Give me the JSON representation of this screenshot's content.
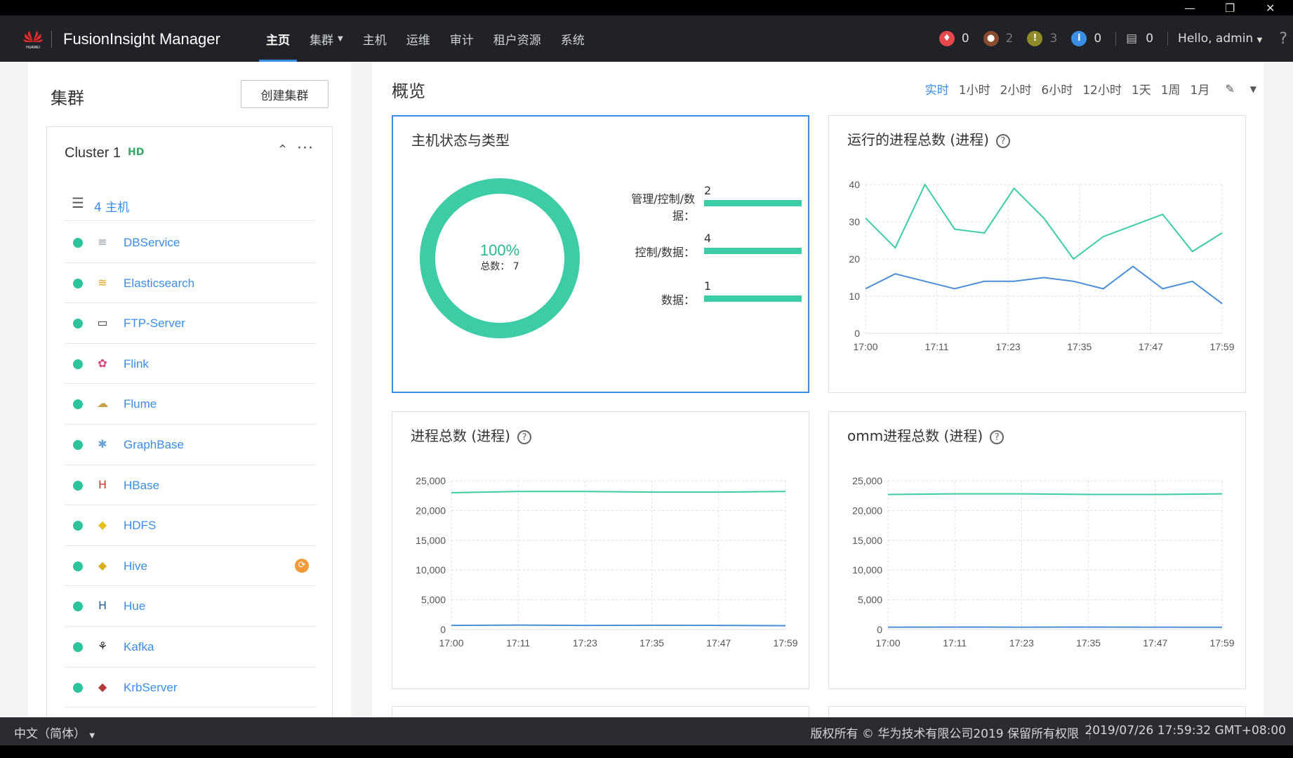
{
  "window": {
    "minimize": "—",
    "restore": "❐",
    "close": "✕"
  },
  "topbar": {
    "brand": "FusionInsight Manager",
    "nav": [
      {
        "label": "主页",
        "active": true,
        "caret": false
      },
      {
        "label": "集群",
        "active": false,
        "caret": true
      },
      {
        "label": "主机",
        "active": false,
        "caret": false
      },
      {
        "label": "运维",
        "active": false,
        "caret": false
      },
      {
        "label": "审计",
        "active": false,
        "caret": false
      },
      {
        "label": "租户资源",
        "active": false,
        "caret": false
      },
      {
        "label": "系统",
        "active": false,
        "caret": false
      }
    ],
    "alarms": [
      {
        "icon": "critical-alarm-icon",
        "color": "#e5484d",
        "count": "0",
        "dim": false
      },
      {
        "icon": "major-alarm-icon",
        "color": "#8a4b2f",
        "count": "2",
        "dim": true
      },
      {
        "icon": "minor-alarm-icon",
        "color": "#8f8a2a",
        "count": "3",
        "dim": true
      },
      {
        "icon": "info-alarm-icon",
        "color": "#3a8ee6",
        "count": "0",
        "dim": false
      }
    ],
    "tasks_count": "0",
    "greeting": "Hello, admin",
    "help": "?"
  },
  "left": {
    "title": "集群",
    "create_button": "创建集群",
    "cluster": {
      "name": "Cluster 1",
      "tag": "HD",
      "hosts_label": "4 主机",
      "services": [
        {
          "name": "DBService",
          "icon": "dbservice-icon",
          "glyph": "≡",
          "color": "#8a8f99",
          "badge": ""
        },
        {
          "name": "Elasticsearch",
          "icon": "elasticsearch-icon",
          "glyph": "≋",
          "color": "#e8a21c",
          "badge": ""
        },
        {
          "name": "FTP-Server",
          "icon": "ftp-server-icon",
          "glyph": "▭",
          "color": "#333",
          "badge": ""
        },
        {
          "name": "Flink",
          "icon": "flink-icon",
          "glyph": "✿",
          "color": "#d9447a",
          "badge": ""
        },
        {
          "name": "Flume",
          "icon": "flume-icon",
          "glyph": "☁",
          "color": "#c8a04a",
          "badge": ""
        },
        {
          "name": "GraphBase",
          "icon": "graphbase-icon",
          "glyph": "✱",
          "color": "#6aa3d8",
          "badge": ""
        },
        {
          "name": "HBase",
          "icon": "hbase-icon",
          "glyph": "H",
          "color": "#c0392b",
          "badge": ""
        },
        {
          "name": "HDFS",
          "icon": "hdfs-icon",
          "glyph": "◆",
          "color": "#e3c11a",
          "badge": ""
        },
        {
          "name": "Hive",
          "icon": "hive-icon",
          "glyph": "◆",
          "color": "#d8b01b",
          "badge": "⟳"
        },
        {
          "name": "Hue",
          "icon": "hue-icon",
          "glyph": "H",
          "color": "#2a5d9f",
          "badge": ""
        },
        {
          "name": "Kafka",
          "icon": "kafka-icon",
          "glyph": "⚘",
          "color": "#222",
          "badge": ""
        },
        {
          "name": "KrbServer",
          "icon": "krbserver-icon",
          "glyph": "◆",
          "color": "#b33b3b",
          "badge": ""
        }
      ]
    }
  },
  "overview": {
    "title": "概览",
    "time_options": [
      "实时",
      "1小时",
      "2小时",
      "6小时",
      "12小时",
      "1天",
      "1周",
      "1月"
    ],
    "active_time": "实时"
  },
  "colors": {
    "green": "#3ccca6",
    "blue": "#4a8ed8",
    "accent": "#3a8ee6"
  },
  "footer": {
    "language": "中文（简体）",
    "copyright": "版权所有 © 华为技术有限公司2019 保留所有权限",
    "time": "2019/07/26 17:59:32 GMT+08:00"
  },
  "chart_data": [
    {
      "type": "donut",
      "title": "主机状态与类型",
      "center_percent": "100%",
      "center_label": "总数：",
      "total": 7,
      "bars": [
        {
          "label": "管理/控制/数据：",
          "value": 2
        },
        {
          "label": "控制/数据：",
          "value": 4
        },
        {
          "label": "数据：",
          "value": 1
        }
      ]
    },
    {
      "type": "line",
      "title": "运行的进程总数 (进程)",
      "x": [
        "17:00",
        "17:05",
        "17:11",
        "17:16",
        "17:20",
        "17:23",
        "17:29",
        "17:32",
        "17:35",
        "17:41",
        "17:47",
        "17:53",
        "17:59"
      ],
      "xticks": [
        "17:00",
        "17:11",
        "17:23",
        "17:35",
        "17:47",
        "17:59"
      ],
      "ylim": [
        0,
        40
      ],
      "yticks": [
        0,
        10,
        20,
        30,
        40
      ],
      "series": [
        {
          "values": [
            31,
            23,
            40,
            28,
            27,
            39,
            31,
            20,
            26,
            29,
            32,
            22,
            27
          ],
          "color": "#3ccca6"
        },
        {
          "values": [
            12,
            16,
            14,
            12,
            14,
            14,
            15,
            14,
            12,
            18,
            12,
            14,
            8
          ],
          "color": "#4a8ed8"
        }
      ]
    },
    {
      "type": "line",
      "title": "进程总数 (进程)",
      "x": [
        "17:00",
        "17:11",
        "17:23",
        "17:35",
        "17:47",
        "17:59"
      ],
      "xticks": [
        "17:00",
        "17:11",
        "17:23",
        "17:35",
        "17:47",
        "17:59"
      ],
      "ylim": [
        0,
        25000
      ],
      "yticks": [
        "0",
        "5,000",
        "10,000",
        "15,000",
        "20,000",
        "25,000"
      ],
      "series": [
        {
          "values": [
            23000,
            23200,
            23200,
            23100,
            23100,
            23200
          ],
          "color": "#3ccca6"
        },
        {
          "values": [
            700,
            750,
            700,
            720,
            700,
            650
          ],
          "color": "#4a8ed8"
        }
      ]
    },
    {
      "type": "line",
      "title": "omm进程总数 (进程)",
      "x": [
        "17:00",
        "17:11",
        "17:23",
        "17:35",
        "17:47",
        "17:59"
      ],
      "xticks": [
        "17:00",
        "17:11",
        "17:23",
        "17:35",
        "17:47",
        "17:59"
      ],
      "ylim": [
        0,
        25000
      ],
      "yticks": [
        "0",
        "5,000",
        "10,000",
        "15,000",
        "20,000",
        "25,000"
      ],
      "series": [
        {
          "values": [
            22700,
            22800,
            22800,
            22700,
            22700,
            22800
          ],
          "color": "#3ccca6"
        },
        {
          "values": [
            400,
            420,
            400,
            410,
            400,
            380
          ],
          "color": "#4a8ed8"
        }
      ]
    }
  ]
}
